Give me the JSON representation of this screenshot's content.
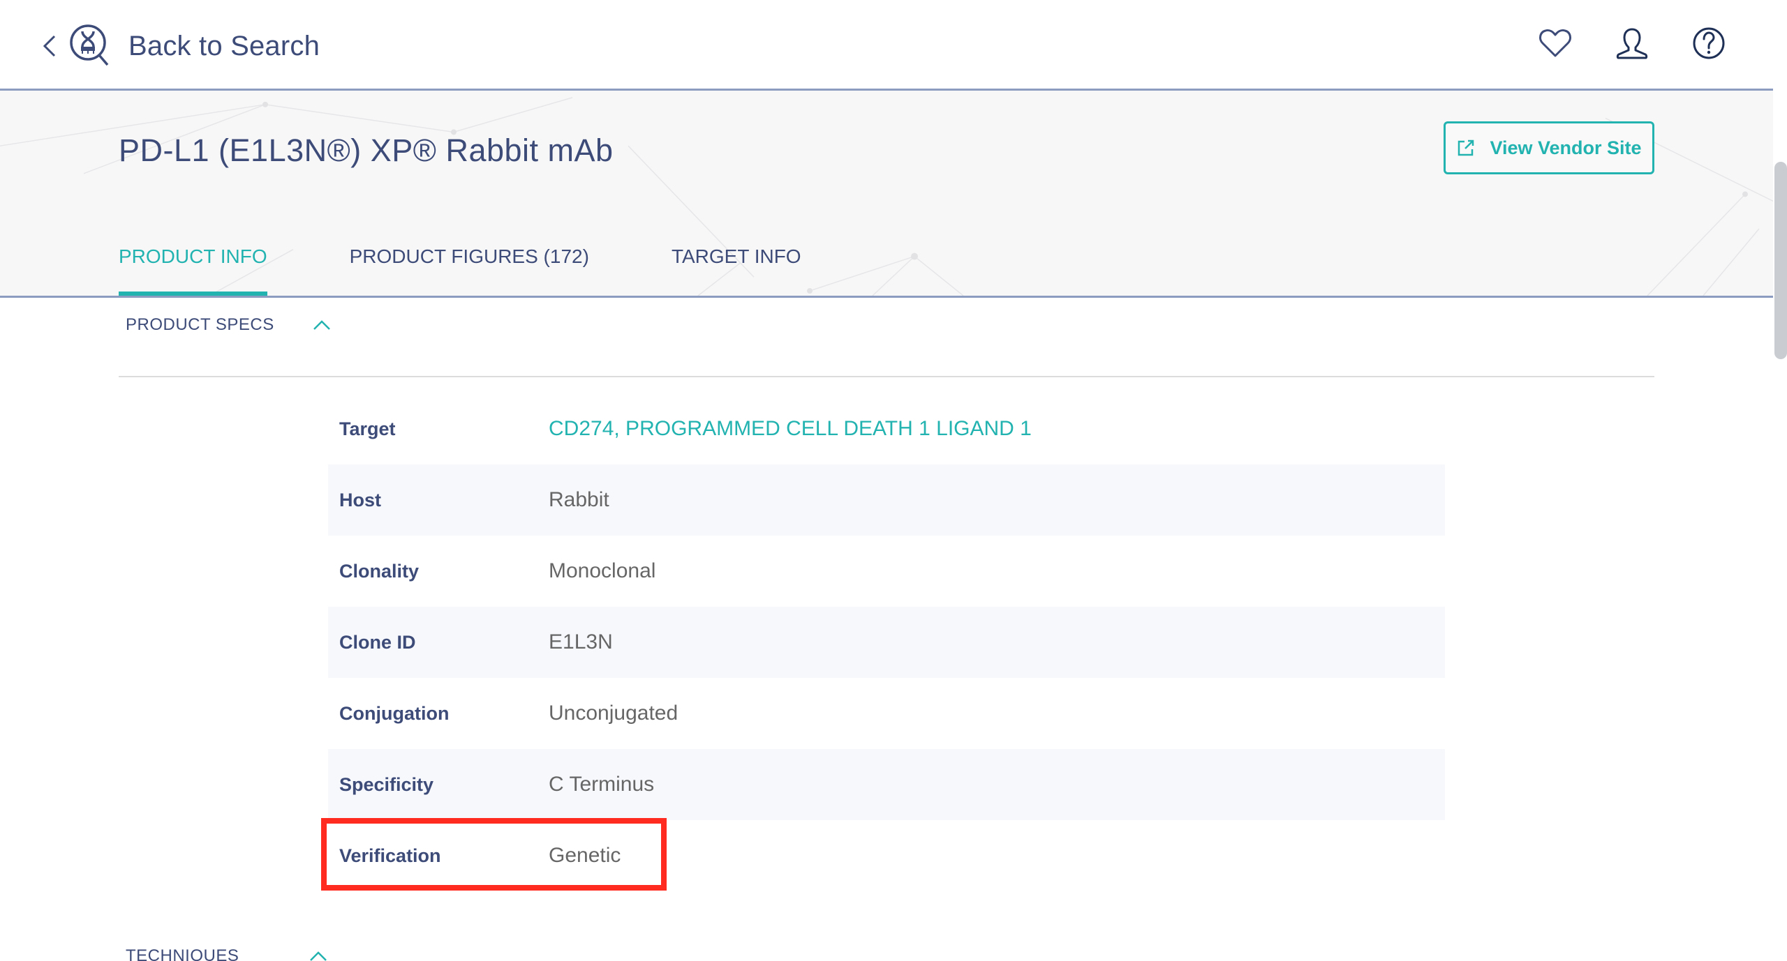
{
  "nav": {
    "back_label": "Back to Search",
    "icons": [
      "chevron-left-icon",
      "dna-search-logo",
      "heart-icon",
      "user-icon",
      "help-icon"
    ]
  },
  "product": {
    "title": "PD-L1 (E1L3N®) XP® Rabbit mAb",
    "vendor_button": "View Vendor Site"
  },
  "tabs": [
    {
      "label": "PRODUCT INFO",
      "active": true
    },
    {
      "label": "PRODUCT FIGURES (172)",
      "active": false
    },
    {
      "label": "TARGET INFO",
      "active": false
    }
  ],
  "sections": {
    "product_specs": "PRODUCT SPECS",
    "techniques": "TECHNIQUES"
  },
  "specs": [
    {
      "key": "Target",
      "value": "CD274, PROGRAMMED CELL DEATH 1 LIGAND 1",
      "link": true
    },
    {
      "key": "Host",
      "value": "Rabbit"
    },
    {
      "key": "Clonality",
      "value": "Monoclonal"
    },
    {
      "key": "Clone ID",
      "value": "E1L3N"
    },
    {
      "key": "Conjugation",
      "value": "Unconjugated"
    },
    {
      "key": "Specificity",
      "value": "C Terminus"
    },
    {
      "key": "Verification",
      "value": "Genetic"
    }
  ],
  "highlighted_row": "Verification",
  "colors": {
    "accent": "#22b3b0",
    "text": "#3d4b78",
    "highlight": "#ff2a20"
  }
}
